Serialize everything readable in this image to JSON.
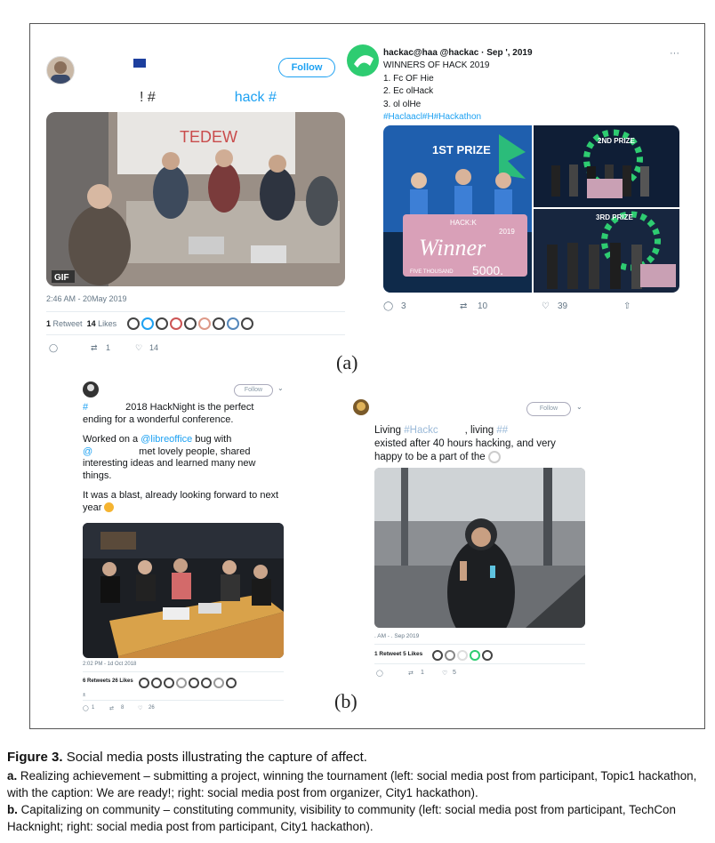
{
  "tweet_a_left": {
    "follow_label": "Follow",
    "text_part1": "! #",
    "text_part2": "hack #",
    "gif_badge": "GIF",
    "timestamp": "2:46 AM - 20May 2019",
    "retweets_count": "1",
    "retweets_label": "Retweet",
    "likes_count": "14",
    "likes_label": "Likes",
    "reply_count": "",
    "retweet_action_count": "1",
    "like_action_count": "14",
    "banner_text": "TEDEW"
  },
  "tweet_a_right": {
    "handle_line": "hackac@haa @hackac · Sep ', 2019",
    "line1": "WINNERS OF HACK        2019",
    "line2": "1. Fc OF Hie",
    "line3": "2. Ec olHack",
    "line4": "3. ol olHe",
    "hashtags": "#Haclaacl#H#Hackathon",
    "prize1": "1ST PRIZE",
    "prize2": "2ND PRIZE",
    "prize3": "3RD PRIZE",
    "winner_word": "Winner",
    "winner_year": "2019",
    "winner_brand": "HACK:K",
    "winner_amount": "5000.",
    "winner_sub": "FIVE THOUSAND",
    "reply_count": "3",
    "retweet_count": "10",
    "like_count": "39",
    "more": "···"
  },
  "tweet_b_left": {
    "follow_label": "Follow",
    "line1_hash": "#",
    "line1_rest": "2018 HackNight is the perfect",
    "line2": "ending for a wonderful conference.",
    "line3_pre": "Worked on a ",
    "line3_link": "@libreoffice",
    "line3_post": " bug with",
    "line4_at": "@",
    "line4_rest": "met lovely people, shared",
    "line5": "interesting ideas and learned many new",
    "line6": "things.",
    "line7": "It was a blast, already looking forward to next",
    "line8": "year",
    "timestamp": "2:02 PM - 1d Oct 2018",
    "retweets": "6 Retweets",
    "likes": "26 Likes",
    "reply_count": "1",
    "retweet_count": "8",
    "like_count": "26"
  },
  "tweet_b_right": {
    "follow_label": "Follow",
    "line1_pre": "Living ",
    "line1_tag": "#Hackc",
    "line1_mid": ", living ",
    "line1_tag2": "##",
    "line2": "existed after 40 hours hacking, and very",
    "line3": "happy to be a part of the",
    "timestamp": ". AM - . Sep 2019",
    "retweets": "1 Retweet",
    "likes": "5 Likes",
    "reply_count": "",
    "retweet_count": "1",
    "like_count": "5"
  },
  "labels": {
    "a": "(a)",
    "b": "(b)"
  },
  "caption": {
    "title_bold": "Figure 3.",
    "title_rest": "Social media posts illustrating the capture of affect.",
    "a_bold": "a.",
    "a_text": "Realizing achievement – submitting a project, winning the tournament (left: social media post from participant, Topic1 hackathon, with the caption: We are ready!; right: social media post from organizer, City1 hackathon).",
    "b_bold": "b.",
    "b_text": "Capitalizing on community – constituting community, visibility to community (left: social media post from participant, TechCon Hacknight; right: social media post from participant, City1 hackathon)."
  },
  "colors": {
    "twitter_blue": "#1da1f2",
    "muted": "#657786",
    "prize_green": "#2ecc71"
  }
}
